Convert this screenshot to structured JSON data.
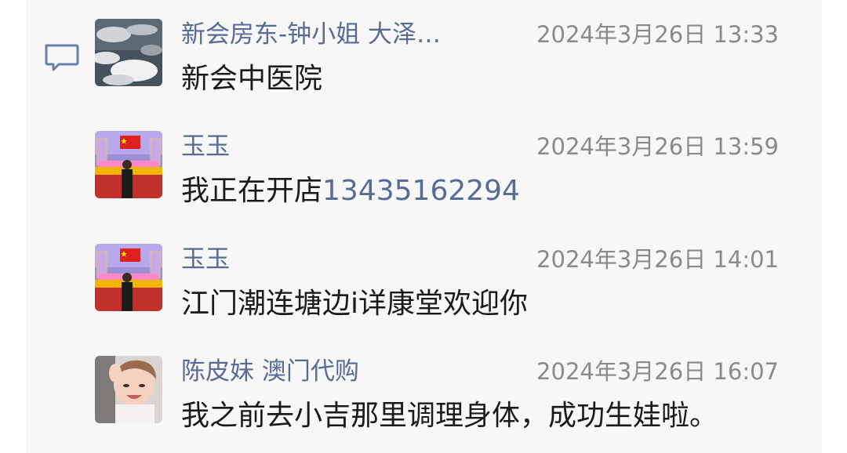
{
  "comments": [
    {
      "name": "新会房东-钟小姐  大泽…",
      "time": "2024年3月26日 13:33",
      "text": "新会中医院",
      "link": "",
      "avatar": "sky-clouds-avatar"
    },
    {
      "name": "玉玉",
      "time": "2024年3月26日 13:59",
      "text": "我正在开店",
      "link": "13435162294",
      "avatar": "flag-gate-avatar"
    },
    {
      "name": "玉玉",
      "time": "2024年3月26日 14:01",
      "text": "江门潮连塘边i详康堂欢迎你",
      "link": "",
      "avatar": "flag-gate-avatar"
    },
    {
      "name": "陈皮妹 澳门代购",
      "time": "2024年3月26日 16:07",
      "text": "我之前去小吉那里调理身体，成功生娃啦。",
      "link": "",
      "avatar": "child-photo-avatar"
    }
  ],
  "icons": {
    "comment": "comment-bubble-icon"
  },
  "colors": {
    "name": "#576b95",
    "time": "#8a8a8a",
    "text": "#1a1a1a",
    "panel": "#f7f7f7"
  }
}
